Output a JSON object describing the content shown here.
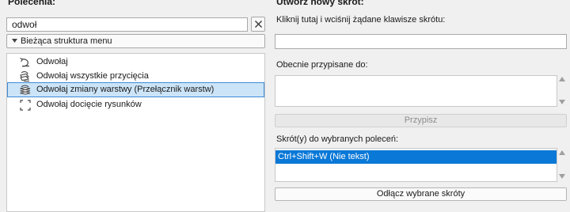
{
  "left": {
    "title": "Polecenia:",
    "search": {
      "value": "odwoł"
    },
    "menu_dropdown": {
      "selected": "Bieżąca struktura menu"
    },
    "commands": [
      {
        "label": "Odwołaj",
        "icon": "undo-icon",
        "selected": false
      },
      {
        "label": "Odwołaj wszystkie przycięcia",
        "icon": "undo-all-trims-icon",
        "selected": false
      },
      {
        "label": "Odwołaj zmiany warstwy (Przełącznik warstw)",
        "icon": "layer-undo-icon",
        "selected": true
      },
      {
        "label": "Odwołaj docięcie rysunków",
        "icon": "crop-drawing-icon",
        "selected": false
      }
    ]
  },
  "right": {
    "title": "Utwórz nowy skrót:",
    "press_keys_label": "Kliknij tutaj i wciśnij żądane klawisze skrótu:",
    "currently_assigned_label": "Obecnie przypisane do:",
    "assign_button": "Przypisz",
    "shortcuts_label": "Skrót(y) do wybranych poleceń:",
    "shortcuts": [
      "Ctrl+Shift+W (Nie tekst)"
    ],
    "detach_button": "Odłącz wybrane skróty"
  },
  "colors": {
    "selection_blue": "#0a78d7",
    "list_selection": "#cce4f7"
  }
}
